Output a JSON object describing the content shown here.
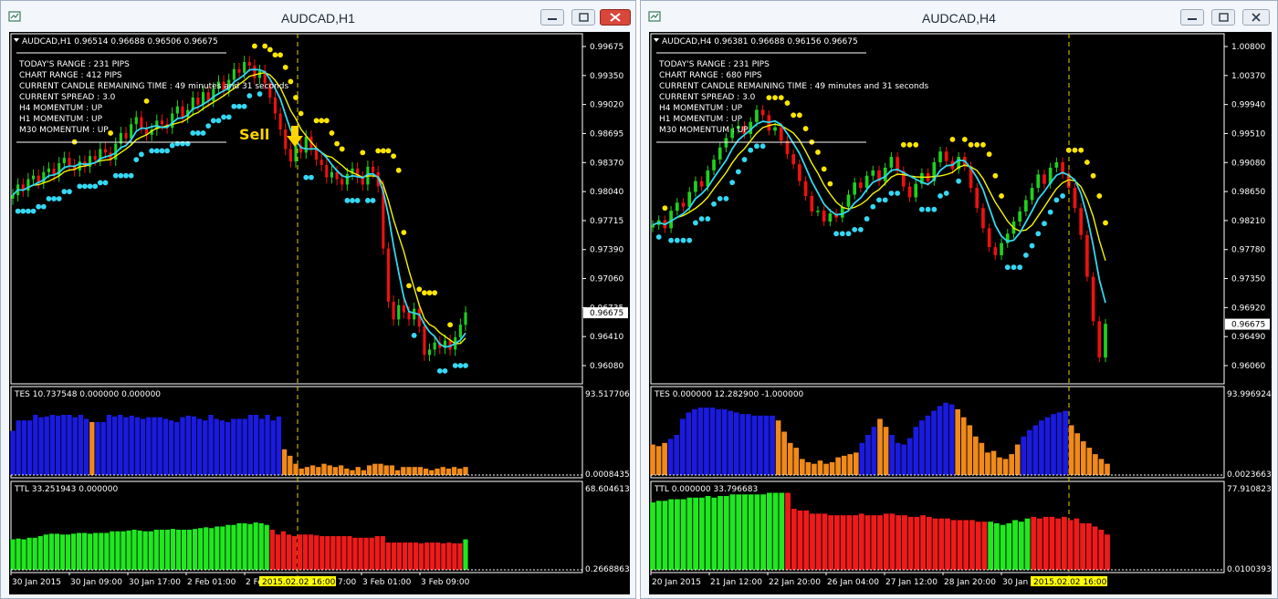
{
  "windows": [
    {
      "id": "left",
      "title": "AUDCAD,H1",
      "header": "AUDCAD,H1  0.96514 0.96688 0.96506 0.96675",
      "info": [
        "TODAY'S RANGE : 231 PIPS",
        "CHART RANGE : 412 PIPS",
        "CURRENT CANDLE REMAINING TIME : 49 minutes and 31 seconds",
        "CURRENT SPREAD : 3.0",
        "H4 MOMENTUM : UP",
        "H1 MOMENTUM : UP",
        "M30 MOMENTUM : UP"
      ],
      "sell_label": "Sell",
      "price_ticks": [
        "0.99675",
        "0.99350",
        "0.99020",
        "0.98695",
        "0.98370",
        "0.98040",
        "0.97715",
        "0.97390",
        "0.97060",
        "0.96735",
        "0.96410",
        "0.96080"
      ],
      "current_price": "0.96675",
      "ind1_label": "TES 10.737548 0.000000 0.000000",
      "ind1_max": "93.517706",
      "ind1_min": "0.00084352",
      "ind2_label": "TTL 33.251943 0.000000",
      "ind2_max": "68.604613",
      "ind2_min": "0.26688636",
      "time_labels": [
        "30 Jan 2015",
        "30 Jan 09:00",
        "30 Jan 17:00",
        "2 Feb 01:00",
        "2 Fe",
        "3 Feb 01:00",
        "3 Feb 09:00"
      ],
      "cursor_time": "2015.02.02 16:00",
      "cursor_tail": "7:00"
    },
    {
      "id": "right",
      "title": "AUDCAD,H4",
      "header": "AUDCAD,H4  0.96381 0.96688 0.96156 0.96675",
      "info": [
        "TODAY'S RANGE : 231 PIPS",
        "CHART RANGE : 680 PIPS",
        "CURRENT CANDLE REMAINING TIME : 49 minutes and 31 seconds",
        "CURRENT SPREAD : 3.0",
        "H4 MOMENTUM : UP",
        "H1 MOMENTUM : UP",
        "M30 MOMENTUM : UP"
      ],
      "sell_label": "",
      "price_ticks": [
        "1.00800",
        "1.00370",
        "0.99940",
        "0.99510",
        "0.99080",
        "0.98650",
        "0.98210",
        "0.97780",
        "0.97350",
        "0.96920",
        "0.96490",
        "0.96060"
      ],
      "current_price": "0.96675",
      "ind1_label": "TES 0.000000 12.282900 -1.000000",
      "ind1_max": "93.996924",
      "ind1_min": "0.00236638",
      "ind2_label": "TTL 0.000000 33.796683",
      "ind2_max": "77.910823",
      "ind2_min": "0.0100393",
      "time_labels": [
        "20 Jan 2015",
        "21 Jan 12:00",
        "22 Jan 20:00",
        "26 Jan 04:00",
        "27 Jan 12:00",
        "28 Jan 20:00",
        "30 Jan 0"
      ],
      "cursor_time": "2015.02.02 16:00",
      "cursor_tail": ""
    }
  ],
  "colors": {
    "bull": "#1fd11f",
    "bear": "#f01010",
    "ma_cyan": "#33d6f0",
    "ma_yellow": "#f5f500",
    "dot_cyan": "#35d8f4",
    "dot_yellow": "#ffe600",
    "tes_blue": "#1a1ae0",
    "tes_orange": "#f08a1a",
    "ttl_green": "#1fe81f",
    "ttl_red": "#f01a1a"
  },
  "icons": {
    "app": "chart-window-icon",
    "minimize": "minimize-icon",
    "restore": "restore-icon",
    "close": "close-icon",
    "sell_arrow": "arrow-down-icon"
  },
  "left_series": {
    "closes": [
      0.98,
      0.9812,
      0.9805,
      0.9818,
      0.9822,
      0.9814,
      0.9826,
      0.983,
      0.9822,
      0.9836,
      0.9842,
      0.9834,
      0.9828,
      0.9838,
      0.9832,
      0.9844,
      0.984,
      0.9852,
      0.9848,
      0.984,
      0.9858,
      0.987,
      0.9864,
      0.988,
      0.9888,
      0.9876,
      0.9868,
      0.9874,
      0.9884,
      0.988,
      0.9876,
      0.9892,
      0.99,
      0.9888,
      0.9896,
      0.991,
      0.9902,
      0.9916,
      0.9906,
      0.992,
      0.9928,
      0.9918,
      0.993,
      0.9942,
      0.9938,
      0.995,
      0.9946,
      0.9932,
      0.994,
      0.9926,
      0.991,
      0.9892,
      0.9874,
      0.9852,
      0.9838,
      0.9856,
      0.9848,
      0.9866,
      0.9852,
      0.984,
      0.9834,
      0.982,
      0.9826,
      0.9818,
      0.9812,
      0.9824,
      0.983,
      0.982,
      0.9812,
      0.9832,
      0.9826,
      0.981,
      0.974,
      0.968,
      0.966,
      0.9676,
      0.9668,
      0.966,
      0.9672,
      0.9652,
      0.962,
      0.9626,
      0.9634,
      0.9628,
      0.9636,
      0.9626,
      0.964,
      0.9654,
      0.9668
    ],
    "tes": [
      55,
      68,
      68,
      68,
      75,
      72,
      73,
      75,
      74,
      75,
      75,
      72,
      75,
      70,
      66,
      66,
      66,
      75,
      73,
      75,
      72,
      74,
      72,
      70,
      72,
      72,
      72,
      70,
      68,
      66,
      72,
      74,
      73,
      70,
      68,
      75,
      70,
      68,
      66,
      70,
      70,
      70,
      75,
      75,
      70,
      75,
      68,
      73,
      32,
      24,
      14,
      8,
      10,
      12,
      10,
      14,
      12,
      10,
      12,
      8,
      6,
      10,
      6,
      12,
      14,
      14,
      12,
      12,
      6,
      10,
      10,
      10,
      10,
      8,
      6,
      8,
      10,
      8,
      10,
      8,
      10
    ],
    "tes_orange_idx": [
      14
    ],
    "ttl": [
      38,
      39,
      38,
      40,
      40,
      42,
      44,
      45,
      45,
      44,
      44,
      45,
      46,
      46,
      45,
      46,
      46,
      46,
      48,
      48,
      48,
      49,
      50,
      49,
      48,
      48,
      50,
      50,
      50,
      51,
      50,
      50,
      50,
      51,
      52,
      53,
      52,
      54,
      54,
      56,
      56,
      58,
      58,
      57,
      59,
      58,
      56,
      50,
      44,
      48,
      44,
      42,
      44,
      44,
      44,
      43,
      42,
      42,
      42,
      42,
      42,
      42,
      40,
      40,
      40,
      40,
      42,
      42,
      34,
      34,
      34,
      34,
      34,
      34,
      33,
      34,
      34,
      34,
      33,
      34,
      33,
      33,
      38
    ]
  },
  "right_series": {
    "closes": [
      0.9815,
      0.9822,
      0.981,
      0.9836,
      0.9848,
      0.9842,
      0.9864,
      0.988,
      0.9872,
      0.9896,
      0.9912,
      0.993,
      0.9944,
      0.9958,
      0.9962,
      0.995,
      0.9968,
      0.9986,
      0.9978,
      0.9955,
      0.996,
      0.994,
      0.992,
      0.9905,
      0.988,
      0.9858,
      0.9835,
      0.9836,
      0.982,
      0.9832,
      0.9826,
      0.9842,
      0.986,
      0.9878,
      0.987,
      0.9888,
      0.9896,
      0.988,
      0.99,
      0.9916,
      0.9895,
      0.9872,
      0.9856,
      0.9876,
      0.9892,
      0.988,
      0.9908,
      0.9924,
      0.991,
      0.9898,
      0.9916,
      0.9902,
      0.987,
      0.984,
      0.981,
      0.9782,
      0.977,
      0.9788,
      0.9802,
      0.982,
      0.9835,
      0.9852,
      0.987,
      0.989,
      0.9876,
      0.99,
      0.9908,
      0.989,
      0.987,
      0.984,
      0.98,
      0.9738,
      0.9672,
      0.9618,
      0.9668
    ],
    "tes": [
      38,
      36,
      40,
      45,
      50,
      70,
      78,
      82,
      84,
      84,
      84,
      82,
      82,
      80,
      78,
      76,
      76,
      74,
      74,
      74,
      74,
      68,
      54,
      40,
      34,
      20,
      16,
      14,
      18,
      14,
      16,
      22,
      24,
      26,
      28,
      40,
      50,
      60,
      70,
      60,
      50,
      40,
      38,
      46,
      60,
      68,
      74,
      80,
      86,
      90,
      88,
      82,
      72,
      62,
      48,
      40,
      28,
      30,
      22,
      20,
      26,
      38,
      48,
      56,
      62,
      68,
      72,
      76,
      78,
      80,
      62,
      52,
      42,
      34,
      26,
      20,
      14
    ],
    "tes_orange_idx": [
      0,
      1,
      2,
      21,
      22,
      23,
      24,
      25,
      26,
      27,
      28,
      29,
      30,
      31,
      32,
      33,
      34,
      38,
      39,
      51,
      52,
      53,
      54,
      55,
      56,
      57,
      58,
      59,
      60,
      61,
      70,
      71,
      72,
      73,
      74,
      75,
      76
    ],
    "ttl": [
      84,
      86,
      86,
      88,
      88,
      88,
      90,
      90,
      90,
      92,
      90,
      92,
      92,
      94,
      94,
      94,
      94,
      94,
      94,
      96,
      96,
      96,
      96,
      76,
      74,
      74,
      70,
      70,
      70,
      68,
      68,
      68,
      68,
      68,
      70,
      68,
      68,
      68,
      70,
      70,
      68,
      68,
      66,
      66,
      68,
      66,
      64,
      64,
      64,
      62,
      62,
      62,
      62,
      60,
      60,
      60,
      58,
      56,
      58,
      62,
      60,
      64,
      66,
      64,
      66,
      66,
      64,
      66,
      62,
      64,
      58,
      58,
      54,
      50,
      44
    ],
    "ttl_green_idx": [
      0,
      22,
      55,
      62,
      70,
      71
    ]
  }
}
